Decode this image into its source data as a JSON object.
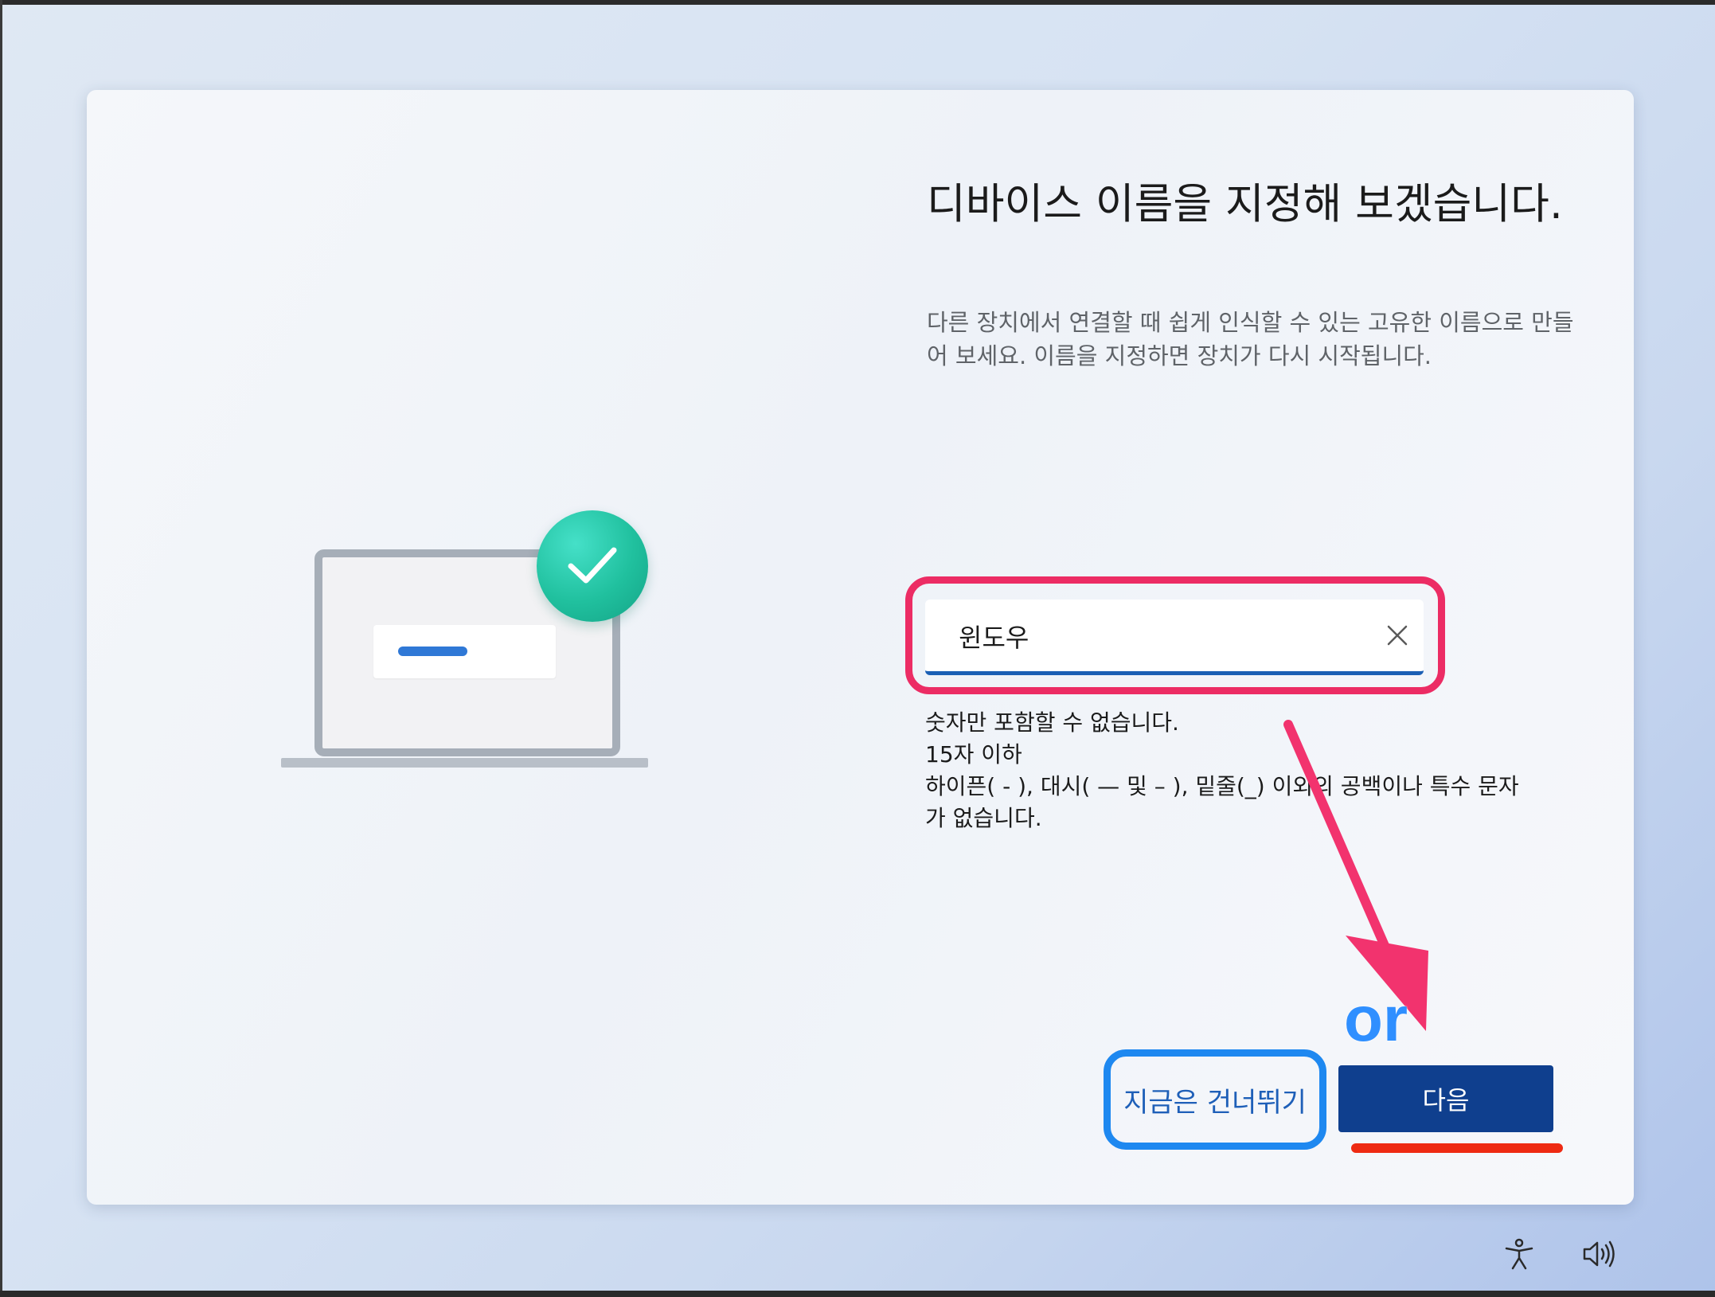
{
  "window": {
    "title": "디바이스 이름을 지정해 보겠습니다.",
    "description": "다른 장치에서 연결할 때 쉽게 인식할 수 있는 고유한 이름으로 만들어 보세요. 이름을 지정하면 장치가 다시 시작됩니다."
  },
  "illustration": {
    "laptop_icon": "laptop-icon",
    "badge_icon": "checkmark-icon",
    "badge_color": "#20c09e"
  },
  "name_field": {
    "value": "윈도우",
    "clear_icon": "close-icon"
  },
  "rules": [
    "숫자만 포함할 수 없습니다.",
    "15자 이하",
    "하이픈( - ), 대시( — 및 – ), 밑줄(_) 이외의 공백이나 특수 문자",
    "가 없습니다."
  ],
  "buttons": {
    "skip_label": "지금은 건너뛰기",
    "next_label": "다음"
  },
  "annotation": {
    "or_text": "or",
    "highlight_color": "#ec2c64",
    "skip_highlight_color": "#1e88f0",
    "underline_color": "#ee2a12"
  },
  "taskbar": {
    "accessibility_icon": "accessibility-icon",
    "volume_icon": "volume-icon"
  }
}
